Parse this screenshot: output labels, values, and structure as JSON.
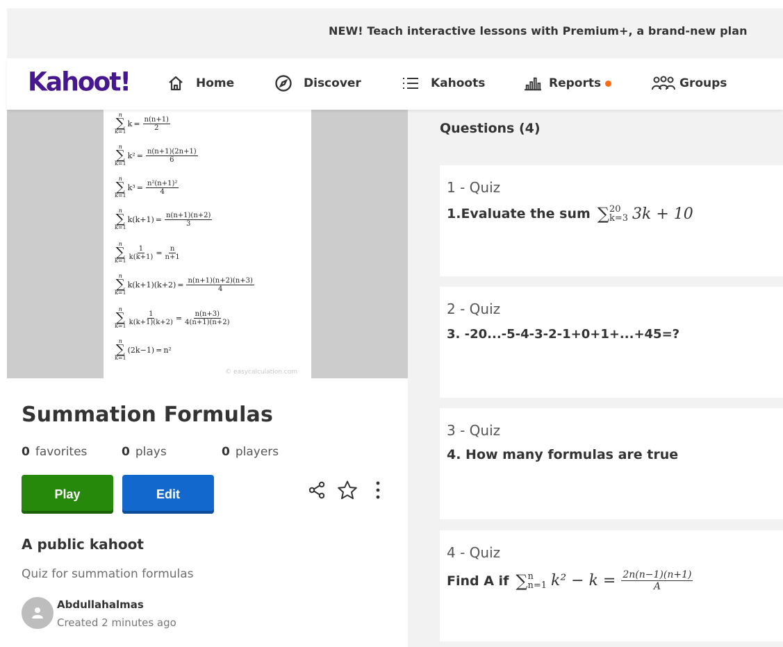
{
  "banner": {
    "text": "NEW! Teach interactive lessons with Premium+, a brand-new plan"
  },
  "nav": {
    "logo": "Kahoot!",
    "items": [
      {
        "label": "Home",
        "icon": "home-icon"
      },
      {
        "label": "Discover",
        "icon": "compass-icon"
      },
      {
        "label": "Kahoots",
        "icon": "list-icon"
      },
      {
        "label": "Reports",
        "icon": "bar-chart-icon",
        "badge_color": "#ff6a13"
      },
      {
        "label": "Groups",
        "icon": "groups-icon"
      }
    ]
  },
  "cover": {
    "formulas": [
      {
        "lhs": "k",
        "frac_num": "n(n+1)",
        "frac_den": "2",
        "tail": ""
      },
      {
        "lhs": "k²",
        "frac_num": "n(n+1)(2n+1)",
        "frac_den": "6",
        "tail": ""
      },
      {
        "lhs": "k³",
        "frac_num": "n²(n+1)²",
        "frac_den": "4",
        "tail": ""
      },
      {
        "lhs": "k(k+1)",
        "frac_num": "n(n+1)(n+2)",
        "frac_den": "3",
        "tail": ""
      },
      {
        "lhs_num": "1",
        "lhs_den": "k(k+1)",
        "frac_num": "n",
        "frac_den": "n+1",
        "tail": ""
      },
      {
        "lhs": "k(k+1)(k+2)",
        "frac_num": "n(n+1)(n+2)(n+3)",
        "frac_den": "4",
        "tail": ""
      },
      {
        "lhs_num": "1",
        "lhs_den": "k(k+1)(k+2)",
        "frac_num": "n(n+3)",
        "frac_den": "4(n+1)(n+2)",
        "tail": ""
      },
      {
        "lhs": "(2k−1)",
        "frac_num": "",
        "frac_den": "",
        "tail": "n²"
      }
    ],
    "sigma_top": "n",
    "sigma_bottom": "k=1",
    "watermark": "© easycalculation.com"
  },
  "kahoot": {
    "title": "Summation Formulas",
    "stats": [
      {
        "value": "0",
        "label": "favorites"
      },
      {
        "value": "0",
        "label": "plays"
      },
      {
        "value": "0",
        "label": "players"
      }
    ],
    "play_label": "Play",
    "edit_label": "Edit",
    "visibility": "A public kahoot",
    "description": "Quiz for summation formulas",
    "author": "Abdullahalmas",
    "created": "Created 2 minutes ago"
  },
  "questions": {
    "header": "Questions (4)",
    "items": [
      {
        "num": "1 - Quiz",
        "text": "1.Evaluate the sum",
        "math": {
          "top": "20",
          "bottom": "k=3",
          "expr": "3k + 10"
        }
      },
      {
        "num": "2 - Quiz",
        "text": "3. -20...-5-4-3-2-1+0+1+...+45=?"
      },
      {
        "num": "3 - Quiz",
        "text": "4. How many formulas are true"
      },
      {
        "num": "4 - Quiz",
        "text": "Find A if",
        "math": {
          "top": "n",
          "bottom": "n=1",
          "expr": "k² − k =",
          "frac_num": "2n(n−1)(n+1)",
          "frac_den": "A"
        }
      }
    ]
  },
  "colors": {
    "brand": "#46178f",
    "play": "#26890c",
    "edit": "#1368ce"
  }
}
